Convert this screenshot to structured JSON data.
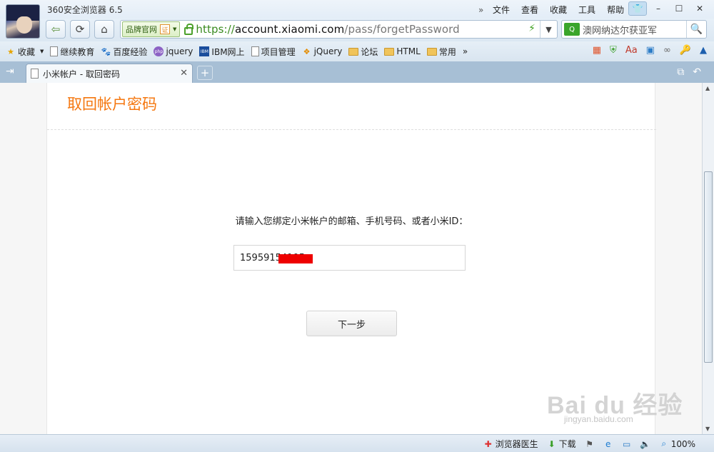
{
  "window": {
    "app_title": "360安全浏览器 6.5",
    "menu": [
      "文件",
      "查看",
      "收藏",
      "工具",
      "帮助"
    ],
    "more_glyph": "»",
    "skin_glyph": "👕",
    "minimize_glyph": "–",
    "maximize_glyph": "☐",
    "close_glyph": "✕"
  },
  "navbar": {
    "back_glyph": "⇦",
    "refresh_glyph": "⟳",
    "home_glyph": "⌂",
    "brand_label": "品牌官网",
    "cert_label": "证",
    "url_scheme": "https://",
    "url_host": "account.xiaomi.com",
    "url_path": "/pass/forgetPassword",
    "bolt_glyph": "⚡",
    "dropdown_glyph": "▼",
    "search_query": "澳网纳达尔获亚军",
    "search_engine_glyph": "Q",
    "search_go_glyph": "🔍"
  },
  "bookmarks": {
    "favorites_label": "收藏",
    "items": [
      {
        "label": "继续教育"
      },
      {
        "label": "百度经验"
      },
      {
        "label": "jquery"
      },
      {
        "label": "IBM网上"
      },
      {
        "label": "项目管理"
      },
      {
        "label": "jQuery"
      },
      {
        "label": "论坛"
      },
      {
        "label": "HTML"
      },
      {
        "label": "常用"
      }
    ],
    "more_glyph": "»",
    "php_icon_text": "php",
    "ibm_icon_text": "IBM"
  },
  "tabs": {
    "sidebar_glyph": "⇥",
    "active_tab_label": "小米帐户 - 取回密码",
    "close_glyph": "✕",
    "new_tab_glyph": "+",
    "restore_glyph": "⧉",
    "undo_glyph": "↶"
  },
  "page": {
    "title": "取回帐户密码",
    "prompt": "请输入您绑定小米帐户的邮箱、手机号码、或者小米ID：",
    "account_value": "15959154195",
    "next_label": "下一步"
  },
  "watermark": {
    "brand": "Bai du 经验",
    "sub": "jingyan.baidu.com"
  },
  "statusbar": {
    "doctor_label": "浏览器医生",
    "download_label": "下载",
    "zoom_label": "100%"
  },
  "colors": {
    "title_orange": "#f5770f",
    "url_green": "#3a8b1f",
    "redaction_red": "#ee0000"
  }
}
